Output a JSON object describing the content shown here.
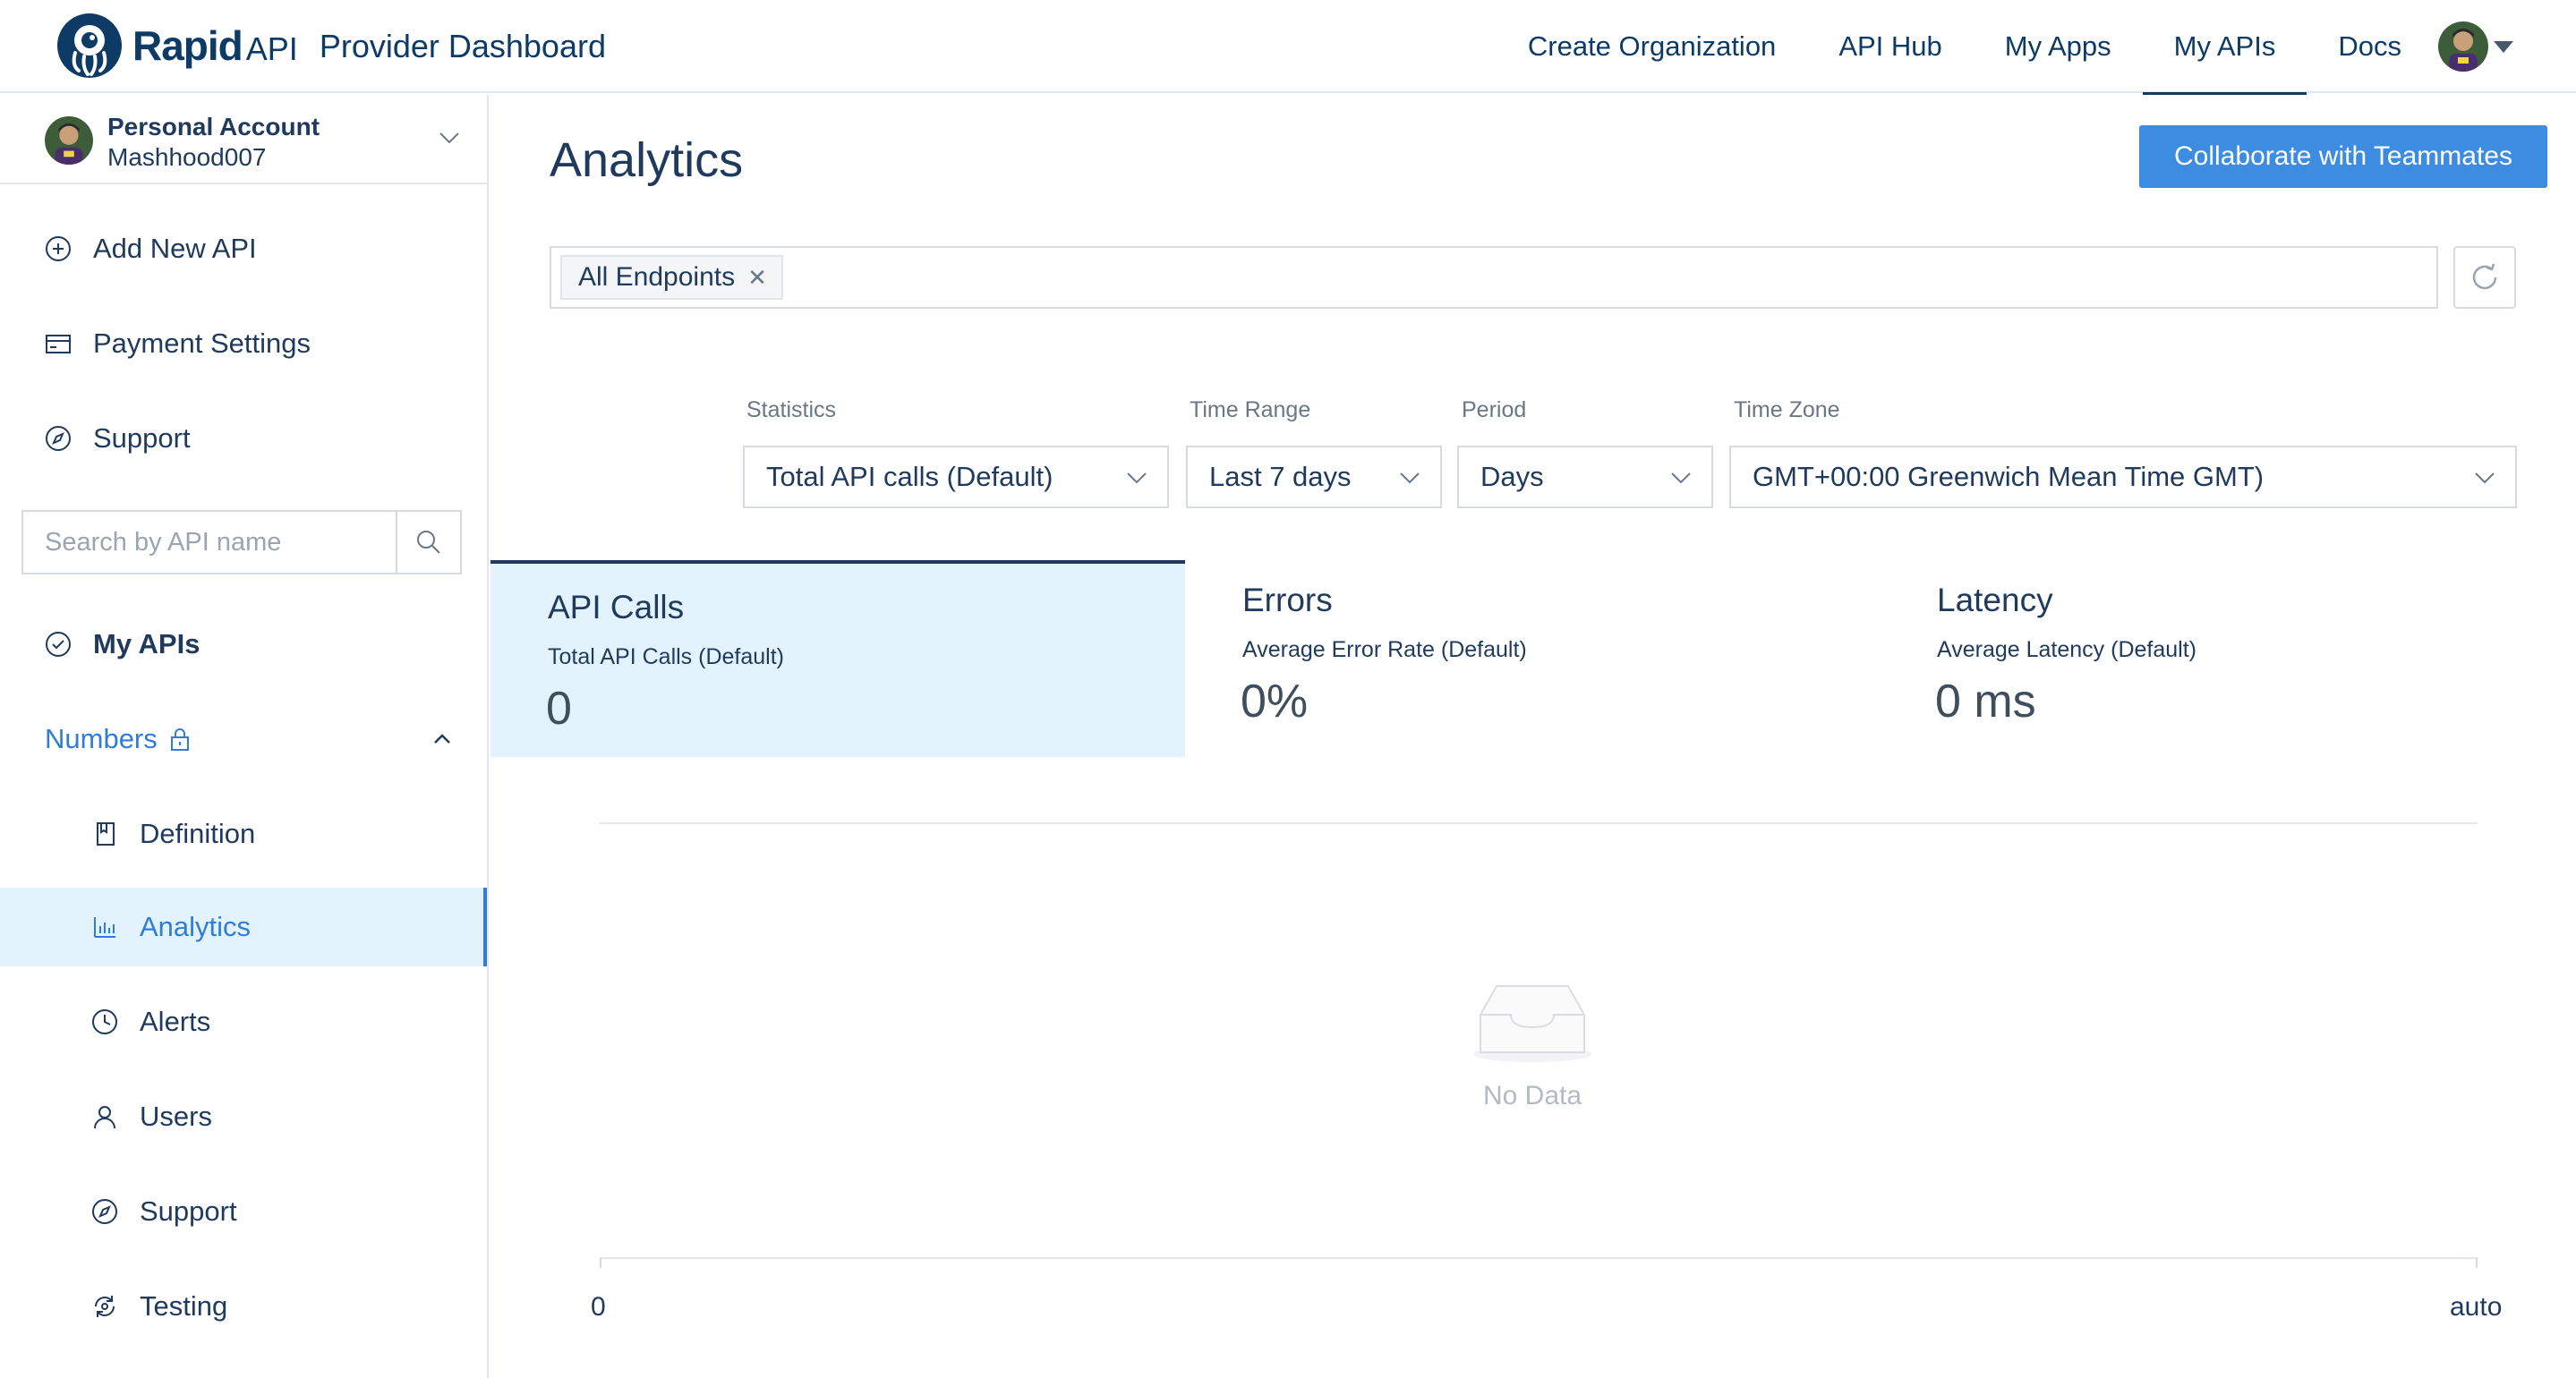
{
  "header": {
    "logo_rapid": "Rapid",
    "logo_api": "API",
    "dashboard_title": "Provider Dashboard",
    "nav": [
      {
        "label": "Create Organization",
        "active": false
      },
      {
        "label": "API Hub",
        "active": false
      },
      {
        "label": "My Apps",
        "active": false
      },
      {
        "label": "My APIs",
        "active": true
      },
      {
        "label": "Docs",
        "active": false
      }
    ]
  },
  "sidebar": {
    "account_type": "Personal Account",
    "account_name": "Mashhood007",
    "items": [
      {
        "label": "Add New API",
        "icon": "plus-circle-icon"
      },
      {
        "label": "Payment Settings",
        "icon": "credit-card-icon"
      },
      {
        "label": "Support",
        "icon": "compass-icon"
      }
    ],
    "search_placeholder": "Search by API name",
    "my_apis_label": "My APIs",
    "api_name": "Numbers",
    "sub_items": [
      {
        "label": "Definition",
        "icon": "book-icon"
      },
      {
        "label": "Analytics",
        "icon": "bar-chart-icon",
        "active": true
      },
      {
        "label": "Alerts",
        "icon": "clock-icon"
      },
      {
        "label": "Users",
        "icon": "user-icon"
      },
      {
        "label": "Support",
        "icon": "compass-icon"
      },
      {
        "label": "Testing",
        "icon": "testing-icon"
      }
    ]
  },
  "main": {
    "title": "Analytics",
    "collab_button": "Collaborate with Teammates",
    "endpoint_tag": "All Endpoints",
    "filters": {
      "statistics": {
        "label": "Statistics",
        "value": "Total API calls (Default)"
      },
      "time_range": {
        "label": "Time Range",
        "value": "Last 7 days"
      },
      "period": {
        "label": "Period",
        "value": "Days"
      },
      "time_zone": {
        "label": "Time Zone",
        "value": "GMT+00:00 Greenwich Mean Time GMT)"
      }
    },
    "tabs": [
      {
        "title": "API Calls",
        "subtitle": "Total API Calls (Default)",
        "value": "0",
        "active": true
      },
      {
        "title": "Errors",
        "subtitle": "Average Error Rate (Default)",
        "value": "0%",
        "active": false
      },
      {
        "title": "Latency",
        "subtitle": "Average Latency (Default)",
        "value": "0 ms",
        "active": false
      }
    ],
    "chart": {
      "no_data": "No Data",
      "x_start": "0",
      "x_end": "auto"
    }
  },
  "colors": {
    "accent": "#2f7dd6",
    "primary_button": "#3c8ce2",
    "navy": "#0e3b66",
    "active_bg": "#e3f3fd"
  }
}
